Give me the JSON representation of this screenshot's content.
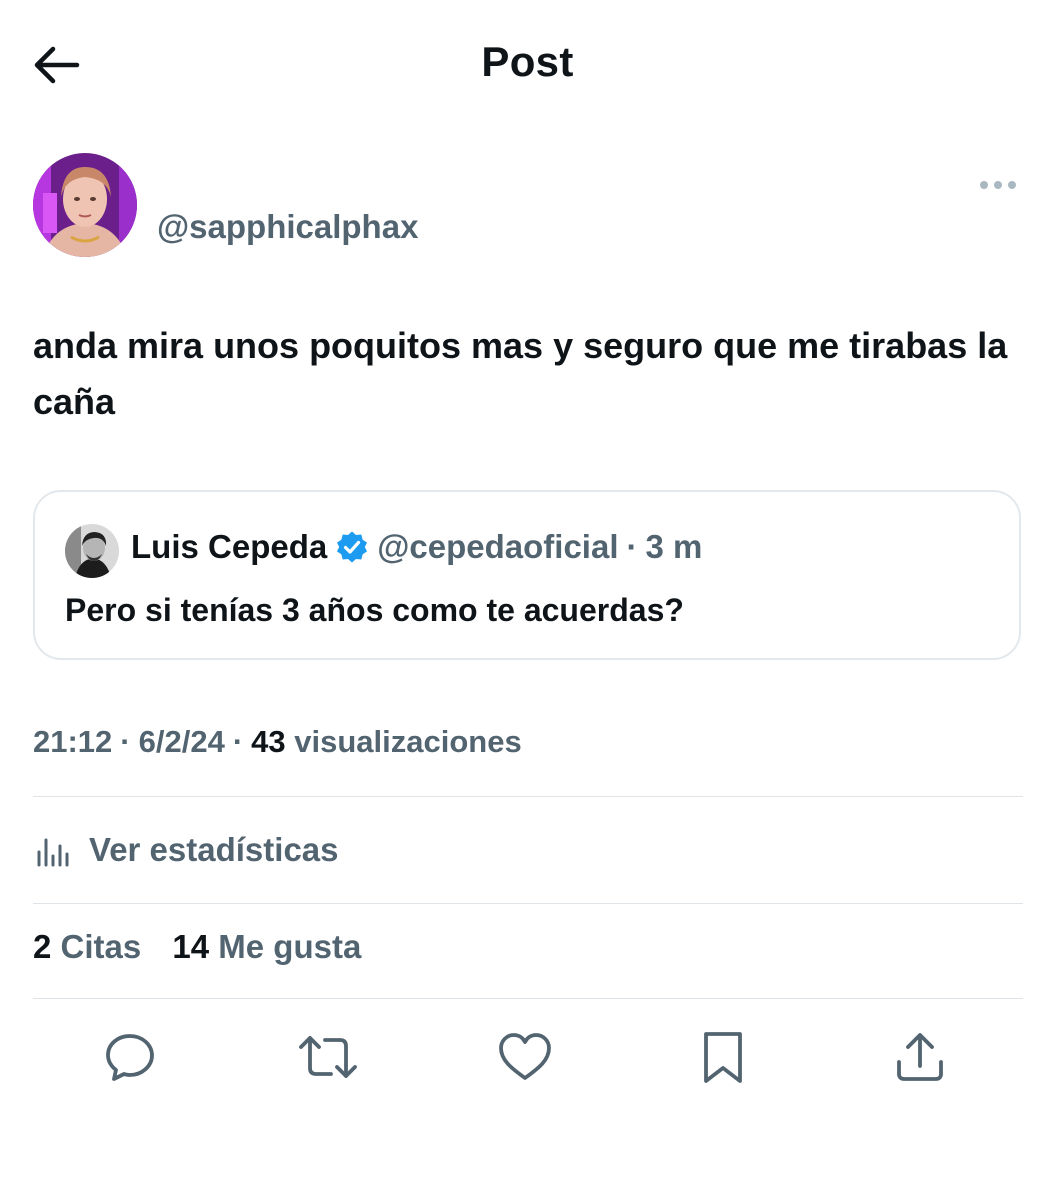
{
  "header": {
    "title": "Post",
    "back_icon": "arrow-left-icon"
  },
  "post": {
    "handle": "@sapphicalphax",
    "text": "anda mira unos poquitos mas y seguro que me tirabas la caña"
  },
  "quote": {
    "name": "Luis Cepeda",
    "handle": "@cepedaoficial",
    "separator": "·",
    "time": "3 m",
    "text": "Pero si tenías 3 años como te acuerdas?"
  },
  "meta": {
    "time": "21:12",
    "date": "6/2/24",
    "views_count": "43",
    "views_label": "visualizaciones",
    "separator": "·"
  },
  "stats": {
    "label": "Ver estadísticas"
  },
  "counts": {
    "quotes_count": "2",
    "quotes_label": "Citas",
    "likes_count": "14",
    "likes_label": "Me gusta"
  },
  "colors": {
    "text_primary": "#0f1419",
    "text_secondary": "#536471",
    "verified_blue": "#1d9bf0",
    "divider": "#dfe4e8"
  },
  "actions": [
    "reply-icon",
    "repost-icon",
    "like-icon",
    "bookmark-icon",
    "share-icon"
  ]
}
